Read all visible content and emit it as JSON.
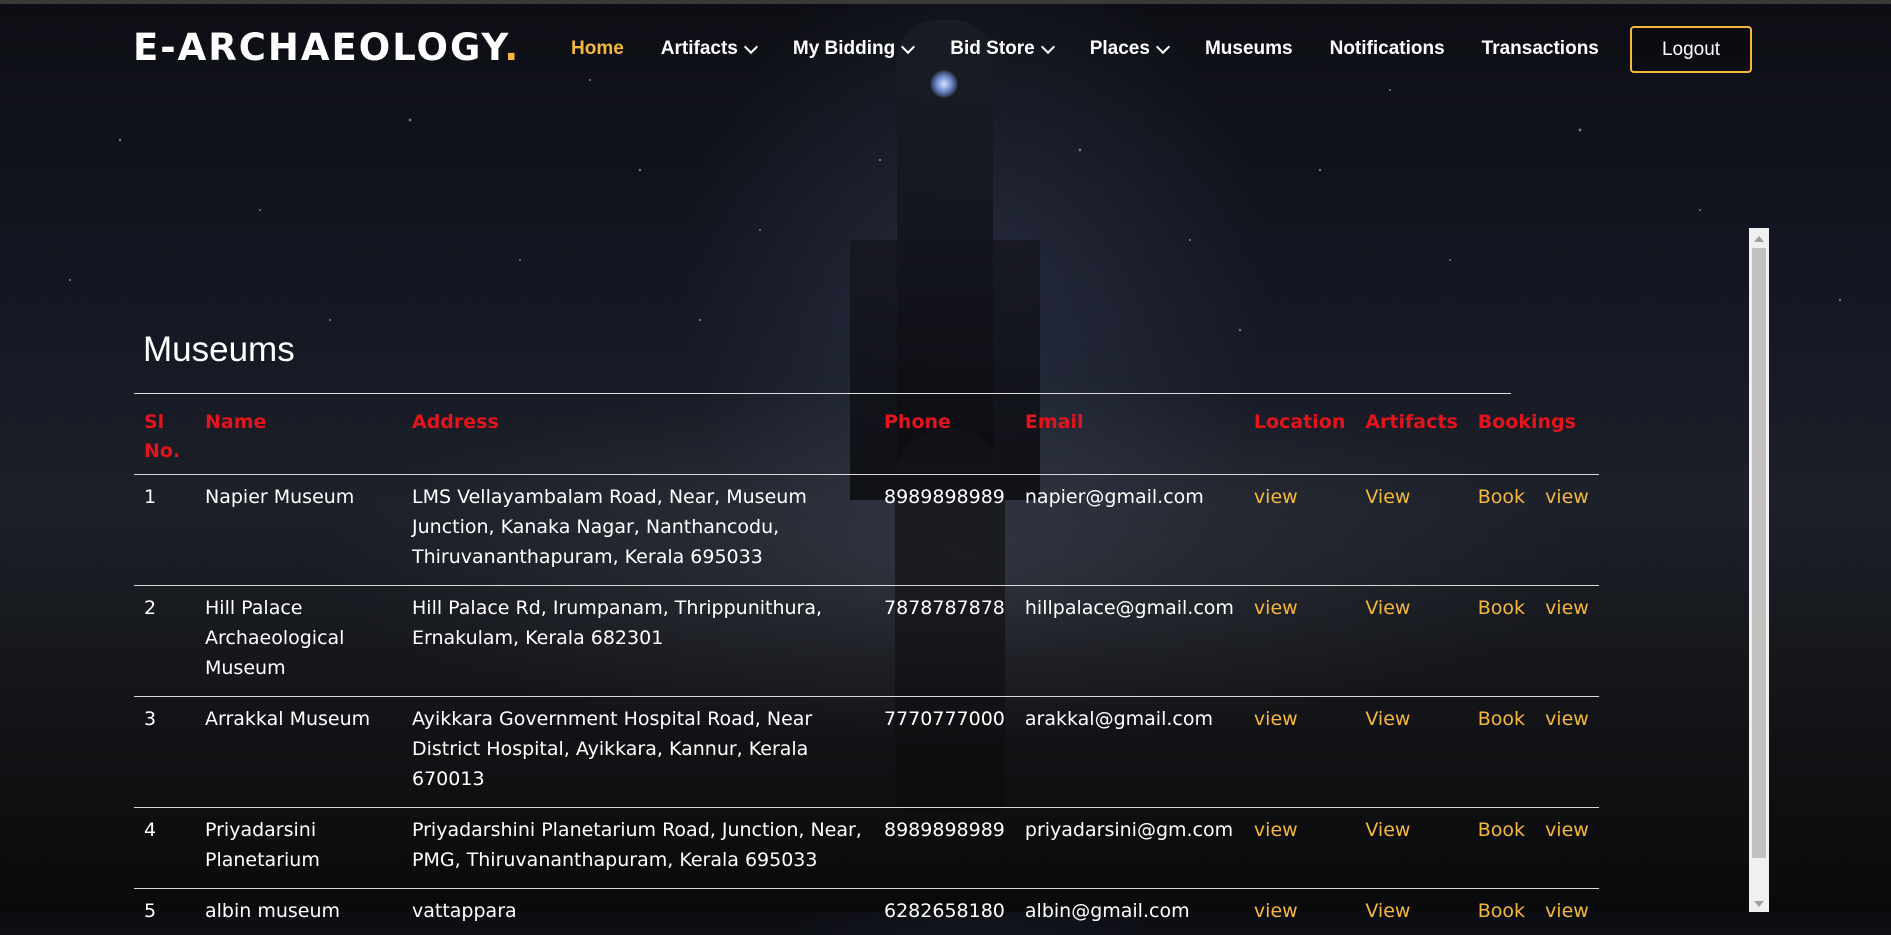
{
  "brand": {
    "name": "E-ARCHAEOLOGY",
    "dot": "."
  },
  "nav": {
    "items": [
      {
        "label": "Home",
        "active": true,
        "dropdown": false
      },
      {
        "label": "Artifacts",
        "active": false,
        "dropdown": true
      },
      {
        "label": "My Bidding",
        "active": false,
        "dropdown": true
      },
      {
        "label": "Bid Store",
        "active": false,
        "dropdown": true
      },
      {
        "label": "Places",
        "active": false,
        "dropdown": true
      },
      {
        "label": "Museums",
        "active": false,
        "dropdown": false
      },
      {
        "label": "Notifications",
        "active": false,
        "dropdown": false
      },
      {
        "label": "Transactions",
        "active": false,
        "dropdown": false
      }
    ],
    "logout_label": "Logout"
  },
  "page": {
    "title": "Museums"
  },
  "table": {
    "headers": [
      "Sl No.",
      "Name",
      "Address",
      "Phone",
      "Email",
      "Location",
      "Artifacts",
      "Bookings"
    ],
    "rows": [
      {
        "sl": "1",
        "name": "Napier Museum",
        "address": "LMS Vellayambalam Road, Near, Museum Junction, Kanaka Nagar, Nanthancodu, Thiruvananthapuram, Kerala 695033",
        "phone": "8989898989",
        "email": "napier@gmail.com",
        "location": "view",
        "artifacts": "View",
        "book": "Book",
        "bookings_view": "view"
      },
      {
        "sl": "2",
        "name": "Hill Palace Archaeological Museum",
        "address": "Hill Palace Rd, Irumpanam, Thrippunithura, Ernakulam, Kerala 682301",
        "phone": "7878787878",
        "email": "hillpalace@gmail.com",
        "location": "view",
        "artifacts": "View",
        "book": "Book",
        "bookings_view": "view"
      },
      {
        "sl": "3",
        "name": "Arrakkal Museum",
        "address": "Ayikkara Government Hospital Road, Near District Hospital, Ayikkara, Kannur, Kerala 670013",
        "phone": "7770777000",
        "email": "arakkal@gmail.com",
        "location": "view",
        "artifacts": "View",
        "book": "Book",
        "bookings_view": "view"
      },
      {
        "sl": "4",
        "name": "Priyadarsini Planetarium",
        "address": "Priyadarshini Planetarium Road, Junction, Near, PMG, Thiruvananthapuram, Kerala 695033",
        "phone": "8989898989",
        "email": "priyadarsini@gm.com",
        "location": "view",
        "artifacts": "View",
        "book": "Book",
        "bookings_view": "view"
      },
      {
        "sl": "5",
        "name": "albin museum",
        "address": "vattappara",
        "phone": "6282658180",
        "email": "albin@gmail.com",
        "location": "view",
        "artifacts": "View",
        "book": "Book",
        "bookings_view": "view"
      }
    ]
  },
  "colors": {
    "accent": "#f5b83d",
    "header_red": "#e3141b"
  }
}
